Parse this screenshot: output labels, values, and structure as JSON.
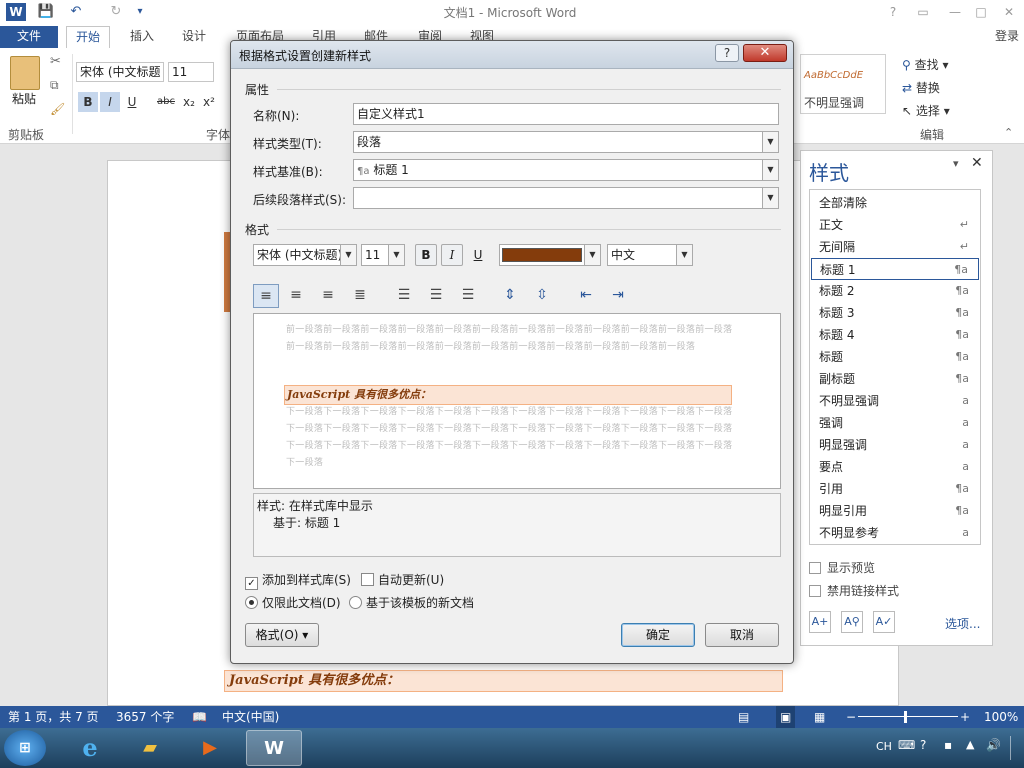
{
  "window": {
    "title": "文档1 - Microsoft Word",
    "help": "?",
    "minimize": "—",
    "restore": "□",
    "close": "✕",
    "signin": "登录"
  },
  "quick_access": {
    "word_icon": "W",
    "save": "💾",
    "undo": "↶",
    "redo": "↻",
    "customize": "▾"
  },
  "ribbon_tabs": [
    "文件",
    "开始",
    "插入",
    "设计",
    "页面布局",
    "引用",
    "邮件",
    "审阅",
    "视图"
  ],
  "ribbon": {
    "paste_label": "粘贴",
    "clipboard_label": "剪贴板",
    "font_label": "字体",
    "font_name": "宋体 (中文标题",
    "font_size": "11",
    "bold": "B",
    "italic": "I",
    "underline": "U",
    "strike": "abc",
    "subscript": "x₂",
    "superscript": "x²",
    "style_preview": "AaBbCcDdE",
    "style_name": "不明显强调",
    "find_label": "查找",
    "replace_label": "替换",
    "select_label": "选择",
    "editing_label": "编辑"
  },
  "document": {
    "heading_text": "JavaScript 具有很多优点：",
    "heading_color": "#843c0c"
  },
  "styles_pane": {
    "title": "样式",
    "items": [
      {
        "label": "全部清除",
        "mark": ""
      },
      {
        "label": "正文",
        "mark": "↵"
      },
      {
        "label": "无间隔",
        "mark": "↵"
      },
      {
        "label": "标题 1",
        "mark": "¶a"
      },
      {
        "label": "标题 2",
        "mark": "¶a"
      },
      {
        "label": "标题 3",
        "mark": "¶a"
      },
      {
        "label": "标题 4",
        "mark": "¶a"
      },
      {
        "label": "标题",
        "mark": "¶a"
      },
      {
        "label": "副标题",
        "mark": "¶a"
      },
      {
        "label": "不明显强调",
        "mark": "a"
      },
      {
        "label": "强调",
        "mark": "a"
      },
      {
        "label": "明显强调",
        "mark": "a"
      },
      {
        "label": "要点",
        "mark": "a"
      },
      {
        "label": "引用",
        "mark": "¶a"
      },
      {
        "label": "明显引用",
        "mark": "¶a"
      },
      {
        "label": "不明显参考",
        "mark": "a"
      }
    ],
    "selected_index": 3,
    "show_preview": "显示预览",
    "disable_linked": "禁用链接样式",
    "options_link": "选项..."
  },
  "dialog": {
    "title": "根据格式设置创建新样式",
    "properties_section": "属性",
    "name_label": "名称(N):",
    "name_value": "自定义样式1",
    "type_label": "样式类型(T):",
    "type_value": "段落",
    "based_on_label": "样式基准(B):",
    "based_on_value": "标题 1",
    "based_on_mark": "¶a",
    "following_label": "后续段落样式(S):",
    "following_value": "",
    "format_section": "格式",
    "font_name": "宋体 (中文标题)",
    "font_size": "11",
    "bold": "B",
    "italic": "I",
    "underline": "U",
    "font_color": "#843c0c",
    "language": "中文",
    "preview_before": "前一段落前一段落前一段落前一段落前一段落前一段落前一段落前一段落前一段落前一段落前一段落前一段落前一段落前一段落前一段落前一段落前一段落前一段落前一段落前一段落前一段落前一段落前一段落",
    "preview_heading": "JavaScript 具有很多优点：",
    "preview_after": "下一段落下一段落下一段落下一段落下一段落下一段落下一段落下一段落下一段落下一段落下一段落下一段落下一段落下一段落下一段落下一段落下一段落下一段落下一段落下一段落下一段落下一段落下一段落下一段落下一段落下一段落下一段落下一段落下一段落下一段落下一段落下一段落下一段落下一段落下一段落下一段落下一段落",
    "desc_line1": "样式: 在样式库中显示",
    "desc_line2": "基于: 标题 1",
    "add_to_gallery": "添加到样式库(S)",
    "auto_update": "自动更新(U)",
    "only_this_doc": "仅限此文档(D)",
    "new_docs_template": "基于该模板的新文档",
    "format_button": "格式(O)",
    "ok_button": "确定",
    "cancel_button": "取消"
  },
  "status_bar": {
    "page": "第 1 页，共 7 页",
    "words": "3657 个字",
    "language": "中文(中国)",
    "zoom": "100%"
  },
  "taskbar": {
    "tray_lang": "CH"
  }
}
